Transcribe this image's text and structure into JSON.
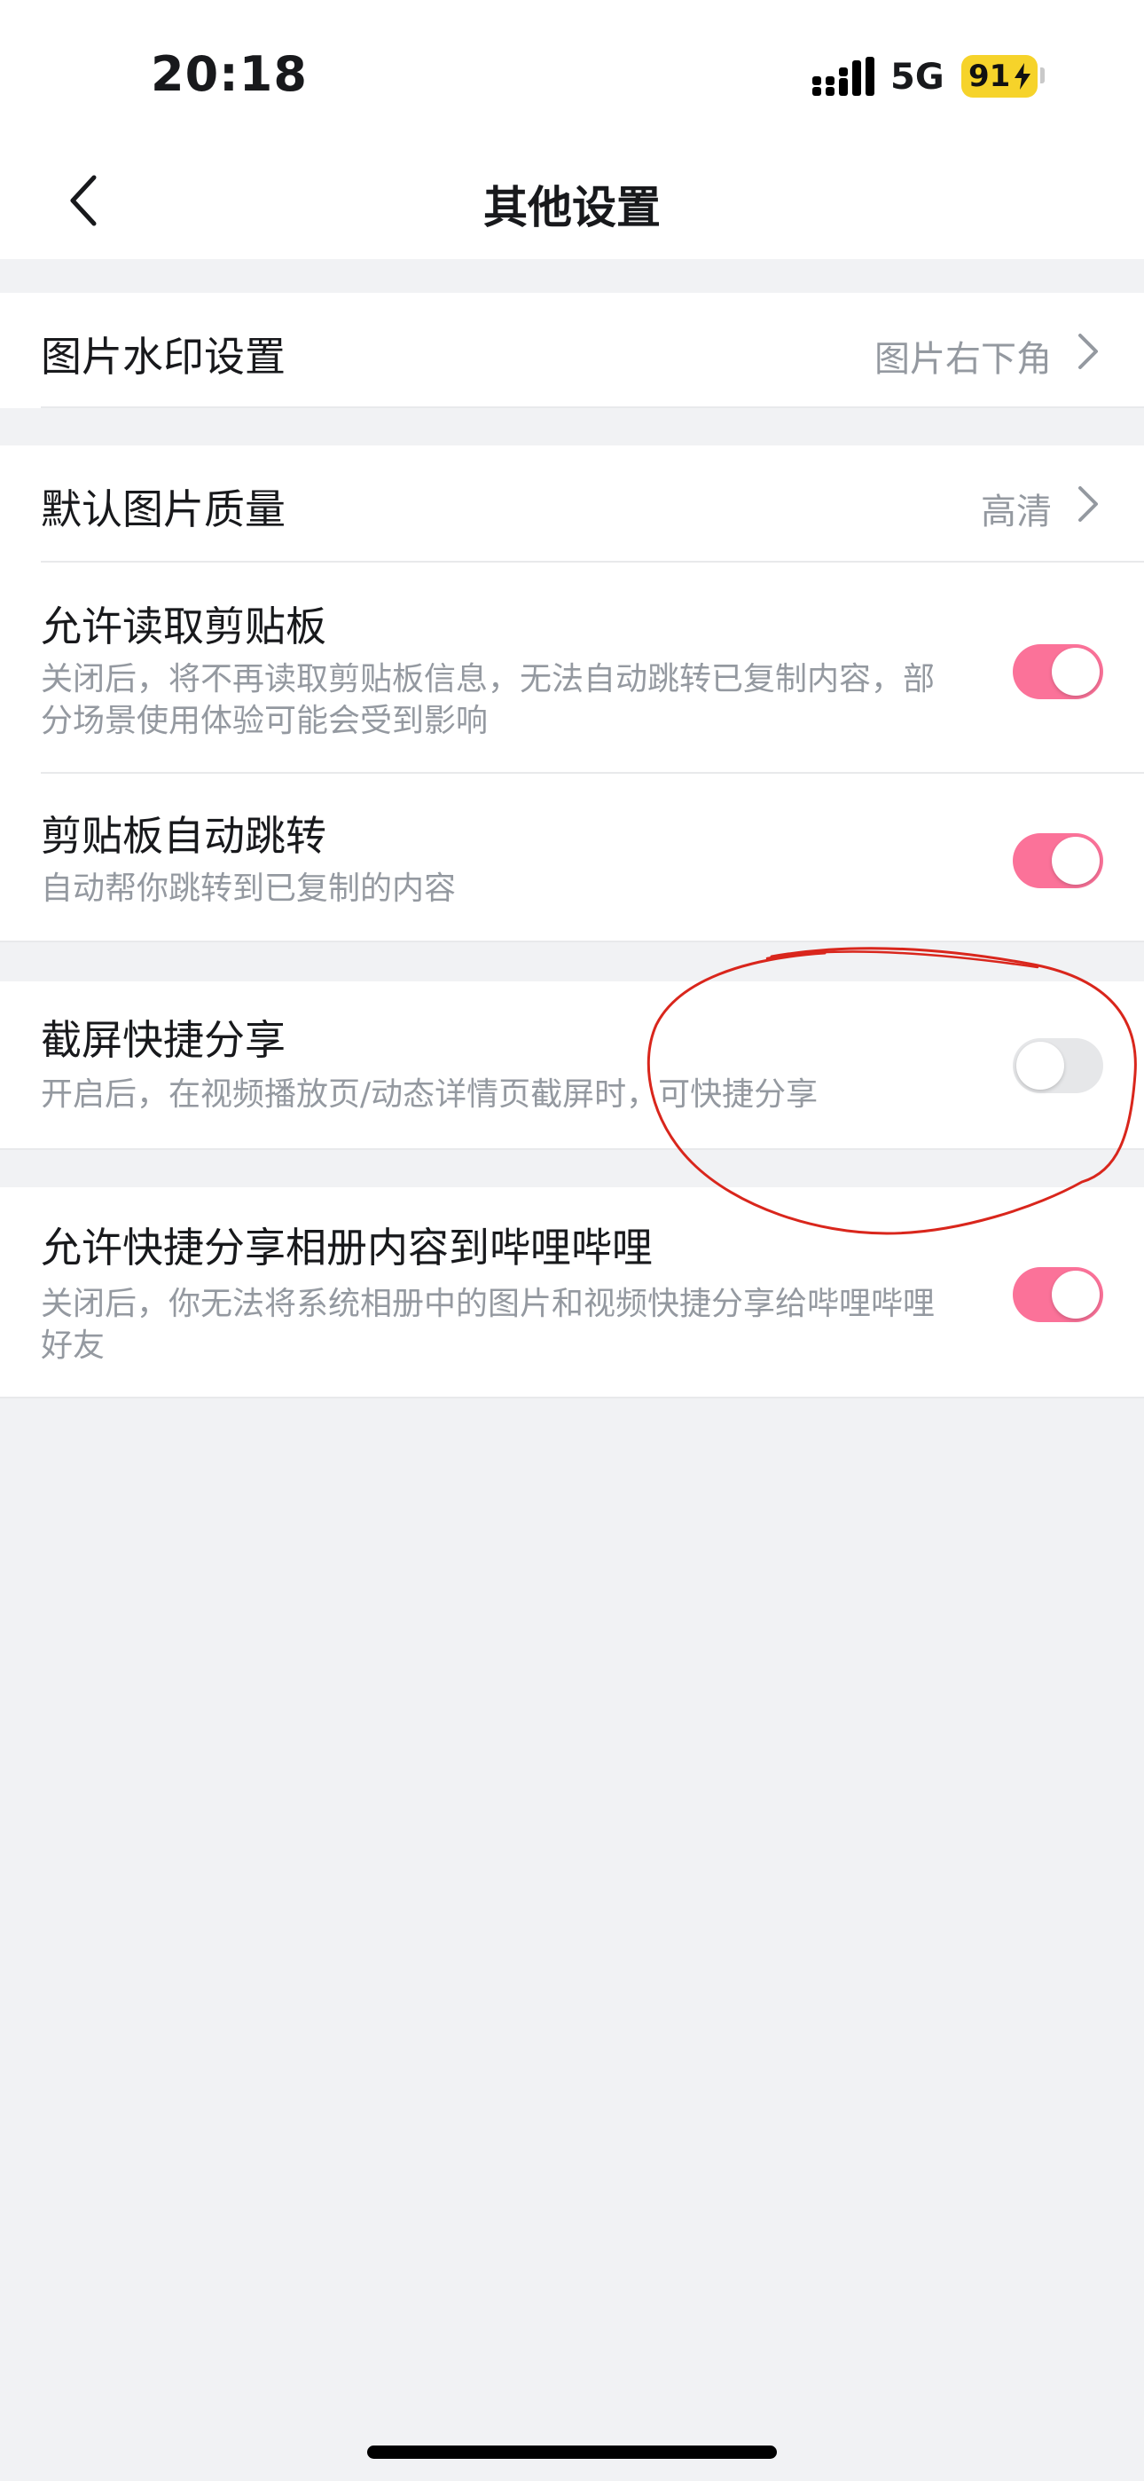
{
  "status_bar": {
    "time": "20:18",
    "network": "5G",
    "battery": "91",
    "signal_icon": "signal-bars-icon",
    "charging_icon": "bolt-icon"
  },
  "nav": {
    "title": "其他设置",
    "back_icon": "chevron-left-icon"
  },
  "settings": {
    "watermark": {
      "title": "图片水印设置",
      "value": "图片右下角"
    },
    "quality": {
      "title": "默认图片质量",
      "value": "高清"
    },
    "clipboard_read": {
      "title": "允许读取剪贴板",
      "desc": "关闭后，将不再读取剪贴板信息，无法自动跳转已复制内容，部分场景使用体验可能会受到影响",
      "enabled": true
    },
    "clipboard_jump": {
      "title": "剪贴板自动跳转",
      "desc": "自动帮你跳转到已复制的内容",
      "enabled": true
    },
    "screenshot_share": {
      "title": "截屏快捷分享",
      "desc": "开启后，在视频播放页/动态详情页截屏时，可快捷分享",
      "enabled": false
    },
    "album_share": {
      "title": "允许快捷分享相册内容到哔哩哔哩",
      "desc": "关闭后，你无法将系统相册中的图片和视频快捷分享给哔哩哔哩好友",
      "enabled": true
    }
  },
  "colors": {
    "accent": "#fb7299",
    "toggle_off": "#e6e7e9",
    "annotation": "#d9261c",
    "battery": "#f6d32a"
  }
}
